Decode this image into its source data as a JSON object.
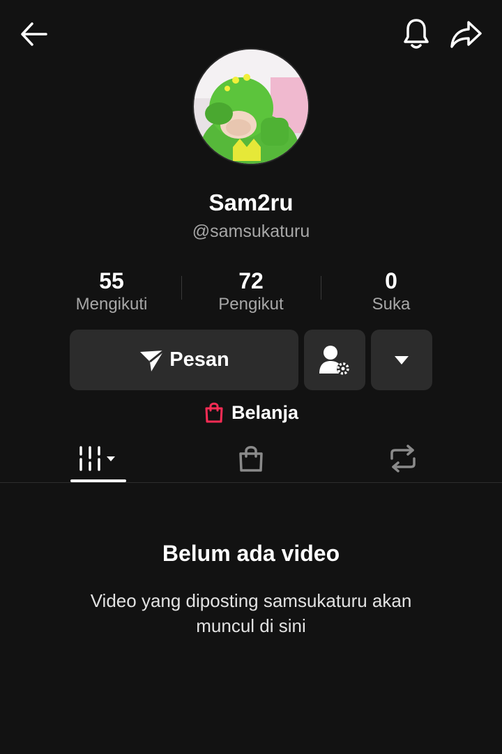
{
  "header": {
    "back_icon": "arrow-left-icon",
    "bell_icon": "bell-icon",
    "share_icon": "share-arrow-icon"
  },
  "profile": {
    "display_name": "Sam2ru",
    "handle": "@samsukaturu"
  },
  "stats": [
    {
      "value": "55",
      "label": "Mengikuti"
    },
    {
      "value": "72",
      "label": "Pengikut"
    },
    {
      "value": "0",
      "label": "Suka"
    }
  ],
  "actions": {
    "message_label": "Pesan",
    "message_icon": "send-icon",
    "friend_settings_icon": "user-gear-icon",
    "more_icon": "caret-down-icon"
  },
  "shop": {
    "label": "Belanja",
    "icon": "shopping-bag-icon",
    "icon_color": "#fe2c55"
  },
  "tabs": [
    {
      "name": "videos",
      "icon": "grid-bars-icon",
      "active": true
    },
    {
      "name": "shop",
      "icon": "shopping-bag-icon",
      "active": false
    },
    {
      "name": "reposts",
      "icon": "repost-icon",
      "active": false
    }
  ],
  "empty_state": {
    "title": "Belum ada video",
    "description": "Video yang diposting samsukaturu akan muncul di sini"
  },
  "colors": {
    "background": "#121212",
    "button": "#2c2c2c",
    "muted_text": "#a7a7a7",
    "accent": "#fe2c55"
  }
}
